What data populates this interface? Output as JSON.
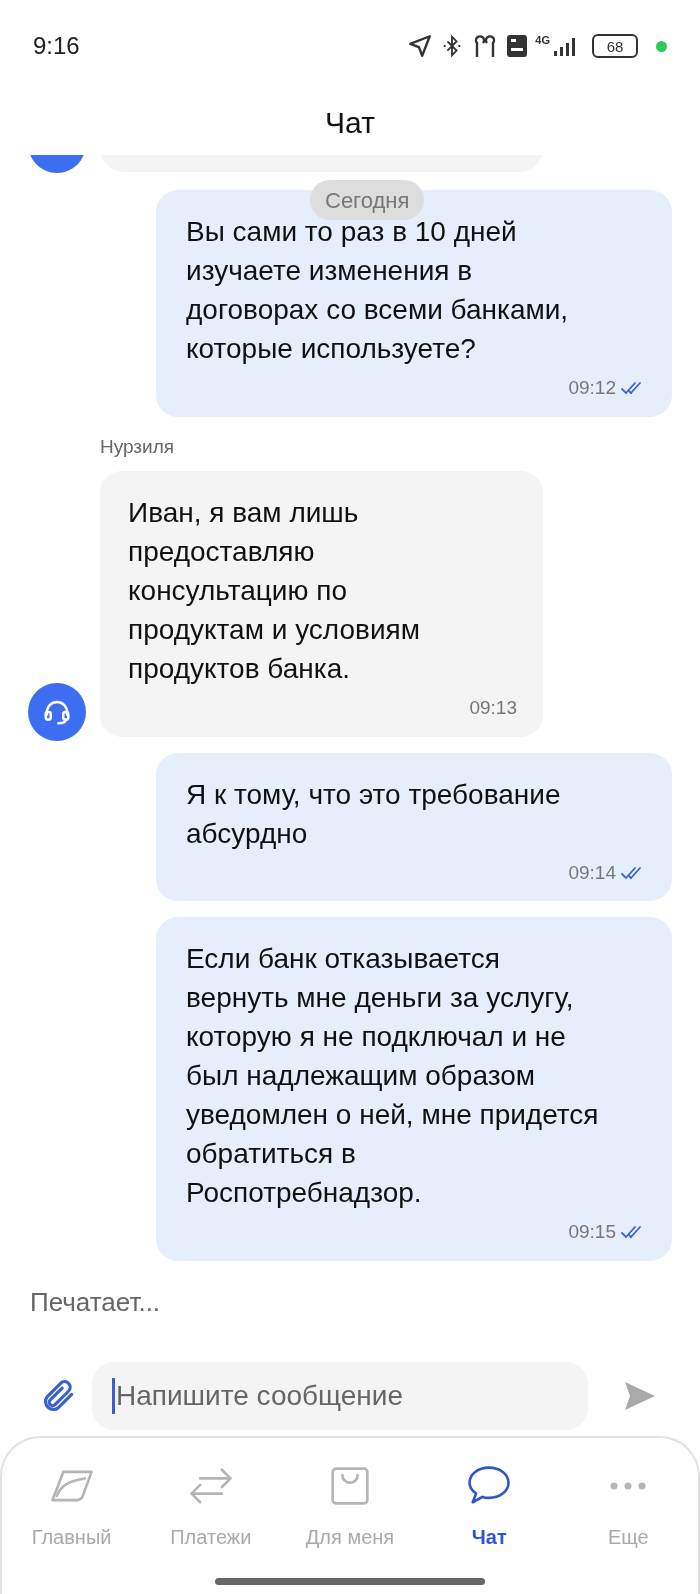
{
  "status_bar": {
    "time": "9:16",
    "network": "4G",
    "battery": "68"
  },
  "header": {
    "title": "Чат"
  },
  "date_chip": "Сегодня",
  "messages": [
    {
      "kind": "outgoing",
      "text": "Вы сами то раз в 10 дней\nизучаете изменения в\nдоговорах со всеми банками,\nкоторые используете?",
      "time": "09:12",
      "read": true
    },
    {
      "kind": "incoming",
      "sender": "Нурзиля",
      "text": "Иван, я вам лишь\nпредоставляю\nконсультацию по\nпродуктам и условиям\nпродуктов банка.",
      "time": "09:13"
    },
    {
      "kind": "outgoing",
      "text": "Я к тому, что это требование\nабсурдно",
      "time": "09:14",
      "read": true
    },
    {
      "kind": "outgoing",
      "text": "Если банк отказывается\nвернуть мне деньги за услугу,\nкоторую я не подключал и не\nбыл надлежащим образом\nуведомлен о ней, мне придется\nобратиться в\nРоспотребнадзор.",
      "time": "09:15",
      "read": true
    }
  ],
  "typing": "Печатает...",
  "composer": {
    "placeholder": "Напишите сообщение"
  },
  "nav": [
    {
      "kind": "home",
      "label": "Главный",
      "selected": false
    },
    {
      "kind": "payments",
      "label": "Платежи",
      "selected": false
    },
    {
      "kind": "shop",
      "label": "Для меня",
      "selected": false
    },
    {
      "kind": "chat",
      "label": "Чат",
      "selected": true
    },
    {
      "kind": "more",
      "label": "Еще",
      "selected": false
    }
  ]
}
